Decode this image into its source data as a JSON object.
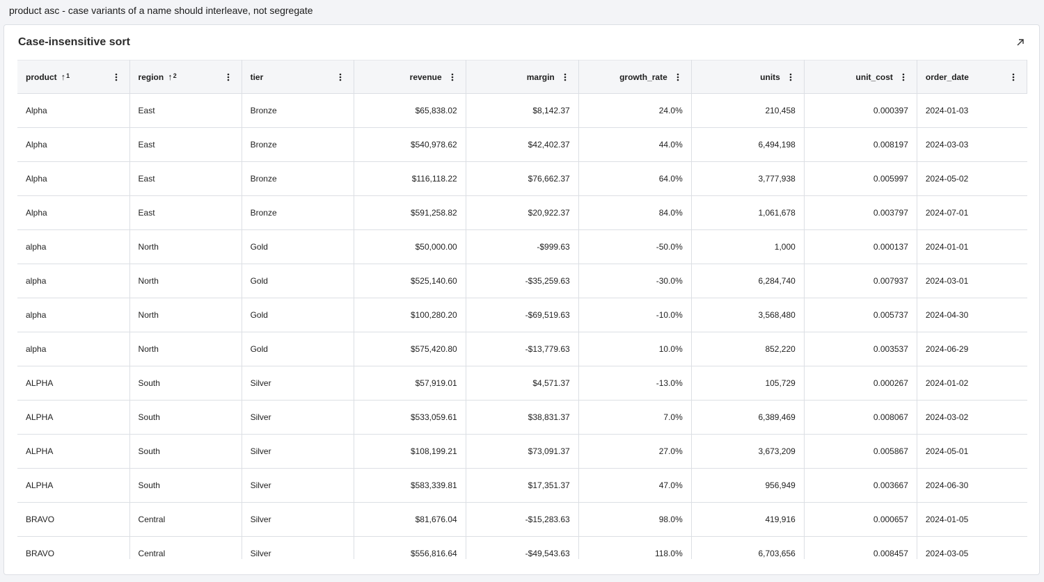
{
  "caption": "product asc - case variants of a name should interleave, not segregate",
  "card": {
    "title": "Case-insensitive sort",
    "expand_icon": "open-in-new-icon"
  },
  "columns": [
    {
      "key": "product",
      "label": "product",
      "align": "left",
      "sort": {
        "direction": "asc",
        "order": "1"
      }
    },
    {
      "key": "region",
      "label": "region",
      "align": "left",
      "sort": {
        "direction": "asc",
        "order": "2"
      }
    },
    {
      "key": "tier",
      "label": "tier",
      "align": "left",
      "sort": null
    },
    {
      "key": "revenue",
      "label": "revenue",
      "align": "right",
      "sort": null
    },
    {
      "key": "margin",
      "label": "margin",
      "align": "right",
      "sort": null
    },
    {
      "key": "growth_rate",
      "label": "growth_rate",
      "align": "right",
      "sort": null
    },
    {
      "key": "units",
      "label": "units",
      "align": "right",
      "sort": null
    },
    {
      "key": "unit_cost",
      "label": "unit_cost",
      "align": "right",
      "sort": null
    },
    {
      "key": "order_date",
      "label": "order_date",
      "align": "left",
      "sort": null
    }
  ],
  "rows": [
    [
      "Alpha",
      "East",
      "Bronze",
      "$65,838.02",
      "$8,142.37",
      "24.0%",
      "210,458",
      "0.000397",
      "2024-01-03"
    ],
    [
      "Alpha",
      "East",
      "Bronze",
      "$540,978.62",
      "$42,402.37",
      "44.0%",
      "6,494,198",
      "0.008197",
      "2024-03-03"
    ],
    [
      "Alpha",
      "East",
      "Bronze",
      "$116,118.22",
      "$76,662.37",
      "64.0%",
      "3,777,938",
      "0.005997",
      "2024-05-02"
    ],
    [
      "Alpha",
      "East",
      "Bronze",
      "$591,258.82",
      "$20,922.37",
      "84.0%",
      "1,061,678",
      "0.003797",
      "2024-07-01"
    ],
    [
      "alpha",
      "North",
      "Gold",
      "$50,000.00",
      "-$999.63",
      "-50.0%",
      "1,000",
      "0.000137",
      "2024-01-01"
    ],
    [
      "alpha",
      "North",
      "Gold",
      "$525,140.60",
      "-$35,259.63",
      "-30.0%",
      "6,284,740",
      "0.007937",
      "2024-03-01"
    ],
    [
      "alpha",
      "North",
      "Gold",
      "$100,280.20",
      "-$69,519.63",
      "-10.0%",
      "3,568,480",
      "0.005737",
      "2024-04-30"
    ],
    [
      "alpha",
      "North",
      "Gold",
      "$575,420.80",
      "-$13,779.63",
      "10.0%",
      "852,220",
      "0.003537",
      "2024-06-29"
    ],
    [
      "ALPHA",
      "South",
      "Silver",
      "$57,919.01",
      "$4,571.37",
      "-13.0%",
      "105,729",
      "0.000267",
      "2024-01-02"
    ],
    [
      "ALPHA",
      "South",
      "Silver",
      "$533,059.61",
      "$38,831.37",
      "7.0%",
      "6,389,469",
      "0.008067",
      "2024-03-02"
    ],
    [
      "ALPHA",
      "South",
      "Silver",
      "$108,199.21",
      "$73,091.37",
      "27.0%",
      "3,673,209",
      "0.005867",
      "2024-05-01"
    ],
    [
      "ALPHA",
      "South",
      "Silver",
      "$583,339.81",
      "$17,351.37",
      "47.0%",
      "956,949",
      "0.003667",
      "2024-06-30"
    ],
    [
      "BRAVO",
      "Central",
      "Silver",
      "$81,676.04",
      "-$15,283.63",
      "98.0%",
      "419,916",
      "0.000657",
      "2024-01-05"
    ],
    [
      "BRAVO",
      "Central",
      "Silver",
      "$556,816.64",
      "-$49,543.63",
      "118.0%",
      "6,703,656",
      "0.008457",
      "2024-03-05"
    ]
  ]
}
